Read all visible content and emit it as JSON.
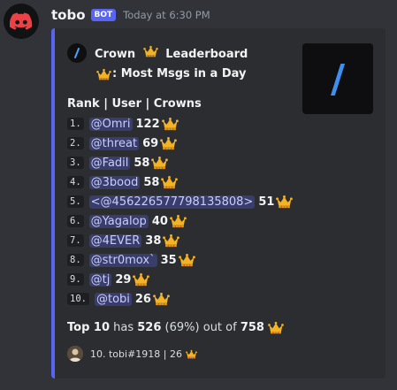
{
  "message": {
    "username": "tobo",
    "bot_badge": "BOT",
    "timestamp": "Today at 6:30 PM"
  },
  "embed": {
    "author_before": "Crown",
    "author_after": "Leaderboard",
    "title": ": Most Msgs in a Day",
    "thumbnail_glyph": "/",
    "table_header": "Rank | User | Crowns",
    "rows": [
      {
        "rank": "1.",
        "user": "@Omri",
        "count": "122"
      },
      {
        "rank": "2.",
        "user": "@threat",
        "count": "69"
      },
      {
        "rank": "3.",
        "user": "@Fadil",
        "count": "58"
      },
      {
        "rank": "4.",
        "user": "@3bood",
        "count": "58"
      },
      {
        "rank": "5.",
        "user": "<@456226577798135808>",
        "count": "51"
      },
      {
        "rank": "6.",
        "user": "@Yagalop",
        "count": "40"
      },
      {
        "rank": "7.",
        "user": "@4EVER",
        "count": "38"
      },
      {
        "rank": "8.",
        "user": "@str0mox`",
        "count": "35"
      },
      {
        "rank": "9.",
        "user": "@tj",
        "count": "29"
      },
      {
        "rank": "10.",
        "user": "@tobi",
        "count": "26"
      }
    ],
    "summary": {
      "label": "Top 10",
      "has": "has",
      "total": "526",
      "percent": "(69%)",
      "out_of": "out of",
      "all": "758"
    },
    "footer": "10. tobi#1918 | 26"
  },
  "colors": {
    "accent": "#5865f2",
    "crown": "#f5b323",
    "background": "#313338",
    "embed_bg": "#2b2d31"
  },
  "icons": {
    "avatar": "discord-logo-icon",
    "crown": "crown-icon"
  }
}
